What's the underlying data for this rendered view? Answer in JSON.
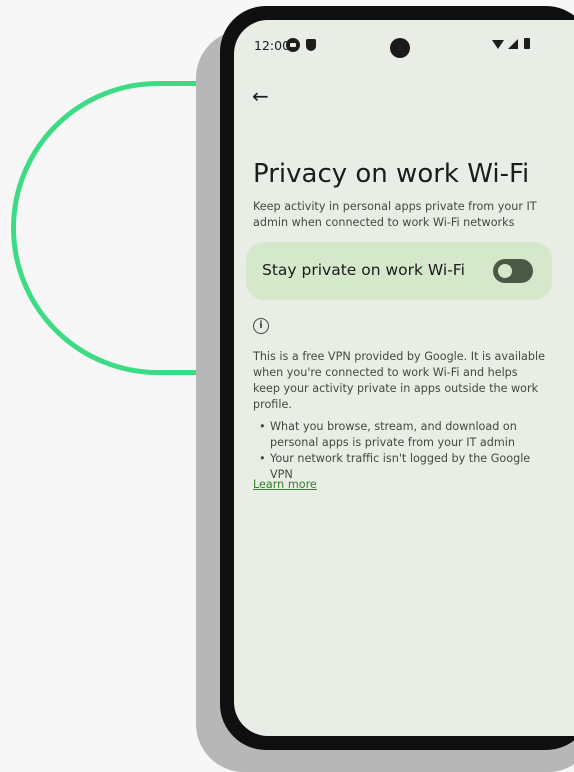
{
  "status_bar": {
    "time": "12:00",
    "icons": [
      "gamepad-icon",
      "shield-icon",
      "wifi-icon",
      "signal-icon",
      "battery-icon"
    ]
  },
  "header": {
    "back_icon": "arrow-back-icon",
    "title": "Privacy on work Wi-Fi",
    "subtitle": "Keep activity in personal apps private from your IT admin when connected to work Wi-Fi networks"
  },
  "toggle": {
    "label": "Stay private on work Wi-Fi",
    "state": "off"
  },
  "info": {
    "icon": "info-icon",
    "text": "This is a free VPN provided by Google. It is available when you're connected to work Wi-Fi and helps keep your activity private in apps outside the work profile.",
    "bullets": [
      "What you browse, stream, and download on personal apps is private from your IT admin",
      "Your network traffic isn't logged by the Google VPN"
    ],
    "link": "Learn more"
  },
  "colors": {
    "arc": "#3ddc84",
    "screen_bg": "#e8eee6",
    "card_bg": "#d6e8cb",
    "link": "#3a7a32"
  }
}
